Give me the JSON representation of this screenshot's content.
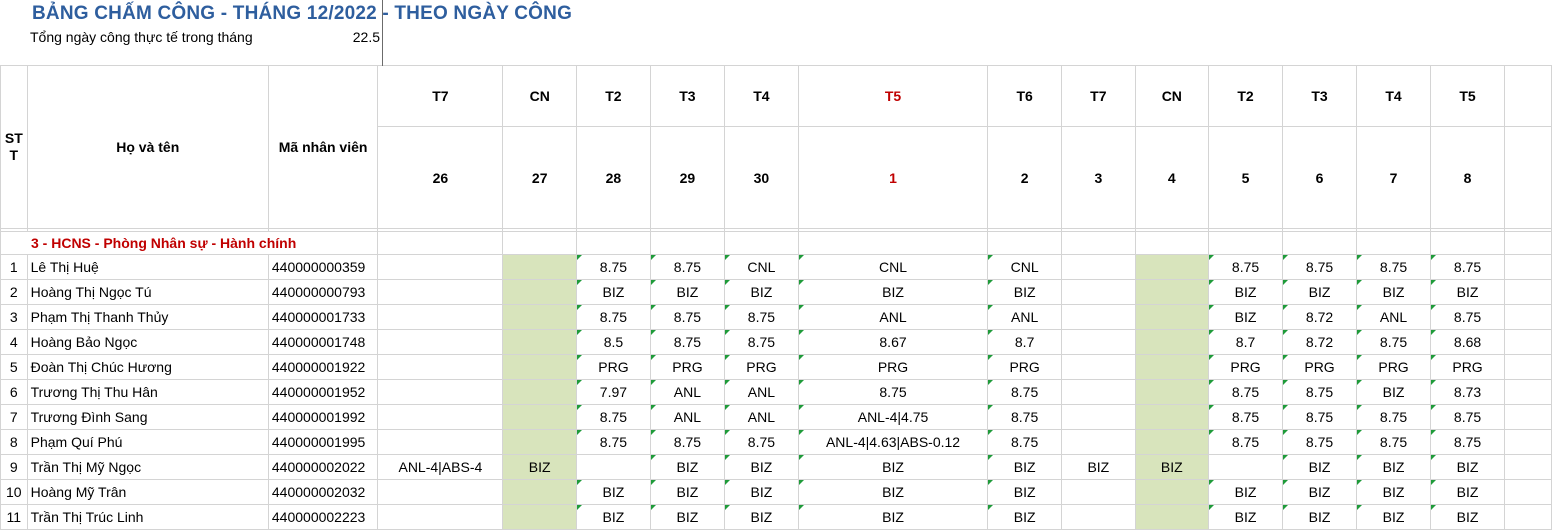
{
  "title": "BẢNG CHẤM CÔNG - THÁNG 12/2022 - THEO NGÀY CÔNG",
  "summary": {
    "label": "Tổng ngày công thực tế trong tháng",
    "value": "22.5"
  },
  "headers": {
    "stt": "ST T",
    "name": "Họ và tên",
    "code": "Mã nhân viên"
  },
  "days": [
    {
      "wd": "T7",
      "d": "26"
    },
    {
      "wd": "CN",
      "d": "27"
    },
    {
      "wd": "T2",
      "d": "28"
    },
    {
      "wd": "T3",
      "d": "29"
    },
    {
      "wd": "T4",
      "d": "30"
    },
    {
      "wd": "T5",
      "d": "1"
    },
    {
      "wd": "T6",
      "d": "2"
    },
    {
      "wd": "T7",
      "d": "3"
    },
    {
      "wd": "CN",
      "d": "4"
    },
    {
      "wd": "T2",
      "d": "5"
    },
    {
      "wd": "T3",
      "d": "6"
    },
    {
      "wd": "T4",
      "d": "7"
    },
    {
      "wd": "T5",
      "d": "8"
    }
  ],
  "section": "3 - HCNS - Phòng Nhân sự - Hành chính",
  "rows": [
    {
      "no": "1",
      "name": "Lê Thị Huệ",
      "code": "440000000359",
      "cells": [
        "",
        "",
        "8.75",
        "8.75",
        "CNL",
        "CNL",
        "CNL",
        "",
        "",
        "8.75",
        "8.75",
        "8.75",
        "8.75"
      ]
    },
    {
      "no": "2",
      "name": "Hoàng Thị Ngọc Tú",
      "code": "440000000793",
      "cells": [
        "",
        "",
        "BIZ",
        "BIZ",
        "BIZ",
        "BIZ",
        "BIZ",
        "",
        "",
        "BIZ",
        "BIZ",
        "BIZ",
        "BIZ"
      ]
    },
    {
      "no": "3",
      "name": "Phạm Thị Thanh Thủy",
      "code": "440000001733",
      "cells": [
        "",
        "",
        "8.75",
        "8.75",
        "8.75",
        "ANL",
        "ANL",
        "",
        "",
        "BIZ",
        "8.72",
        "ANL",
        "8.75"
      ]
    },
    {
      "no": "4",
      "name": "Hoàng Bảo Ngọc",
      "code": "440000001748",
      "cells": [
        "",
        "",
        "8.5",
        "8.75",
        "8.75",
        "8.67",
        "8.7",
        "",
        "",
        "8.7",
        "8.72",
        "8.75",
        "8.68"
      ]
    },
    {
      "no": "5",
      "name": "Đoàn Thị Chúc Hương",
      "code": "440000001922",
      "cells": [
        "",
        "",
        "PRG",
        "PRG",
        "PRG",
        "PRG",
        "PRG",
        "",
        "",
        "PRG",
        "PRG",
        "PRG",
        "PRG"
      ]
    },
    {
      "no": "6",
      "name": "Trương Thị Thu Hân",
      "code": "440000001952",
      "cells": [
        "",
        "",
        "7.97",
        "ANL",
        "ANL",
        "8.75",
        "8.75",
        "",
        "",
        "8.75",
        "8.75",
        "BIZ",
        "8.73"
      ]
    },
    {
      "no": "7",
      "name": "Trương Đình Sang",
      "code": "440000001992",
      "cells": [
        "",
        "",
        "8.75",
        "ANL",
        "ANL",
        "ANL-4|4.75",
        "8.75",
        "",
        "",
        "8.75",
        "8.75",
        "8.75",
        "8.75"
      ]
    },
    {
      "no": "8",
      "name": "Phạm Quí Phú",
      "code": "440000001995",
      "cells": [
        "",
        "",
        "8.75",
        "8.75",
        "8.75",
        "ANL-4|4.63|ABS-0.12",
        "8.75",
        "",
        "",
        "8.75",
        "8.75",
        "8.75",
        "8.75"
      ]
    },
    {
      "no": "9",
      "name": "Trần Thị Mỹ Ngọc",
      "code": "440000002022",
      "cells": [
        "ANL-4|ABS-4",
        "BIZ",
        "",
        "BIZ",
        "BIZ",
        "BIZ",
        "BIZ",
        "BIZ",
        "BIZ",
        "",
        "BIZ",
        "BIZ",
        "BIZ"
      ]
    },
    {
      "no": "10",
      "name": "Hoàng Mỹ Trân",
      "code": "440000002032",
      "cells": [
        "",
        "",
        "BIZ",
        "BIZ",
        "BIZ",
        "BIZ",
        "BIZ",
        "",
        "",
        "BIZ",
        "BIZ",
        "BIZ",
        "BIZ"
      ]
    },
    {
      "no": "11",
      "name": "Trần Thị Trúc Linh",
      "code": "440000002223",
      "cells": [
        "",
        "",
        "BIZ",
        "BIZ",
        "BIZ",
        "BIZ",
        "BIZ",
        "",
        "",
        "BIZ",
        "BIZ",
        "BIZ",
        "BIZ"
      ]
    }
  ],
  "colors": {
    "title": "#2e5e9e",
    "highlight_day": "#c00000",
    "section_text": "#c00000",
    "sunday_fill": "#d8e4bc",
    "comment_marker": "#1f9b3a"
  }
}
